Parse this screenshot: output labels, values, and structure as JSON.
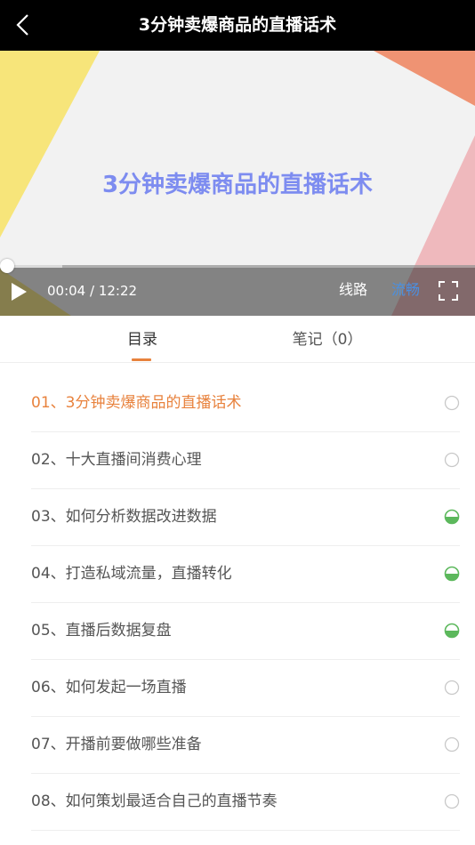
{
  "header": {
    "title": "3分钟卖爆商品的直播话术"
  },
  "video": {
    "slide_title": "3分钟卖爆商品的直播话术",
    "current_time": "00:04",
    "duration": "12:22",
    "route_label": "线路",
    "quality_label": "流畅",
    "progress_fraction": 0.005
  },
  "tabs": [
    {
      "label": "目录",
      "active": true
    },
    {
      "label": "笔记（0）",
      "active": false
    }
  ],
  "lessons": [
    {
      "label": "01、3分钟卖爆商品的直播话术",
      "status": "empty",
      "active": true
    },
    {
      "label": "02、十大直播间消费心理",
      "status": "empty",
      "active": false
    },
    {
      "label": "03、如何分析数据改进数据",
      "status": "half",
      "active": false
    },
    {
      "label": "04、打造私域流量，直播转化",
      "status": "half",
      "active": false
    },
    {
      "label": "05、直播后数据复盘",
      "status": "half",
      "active": false
    },
    {
      "label": "06、如何发起一场直播",
      "status": "empty",
      "active": false
    },
    {
      "label": "07、开播前要做哪些准备",
      "status": "empty",
      "active": false
    },
    {
      "label": "08、如何策划最适合自己的直播节奏",
      "status": "empty",
      "active": false
    }
  ],
  "colors": {
    "accent": "#e8823d",
    "progress_green": "#5cb85c",
    "quality_blue": "#4a90e2",
    "slide_title": "#7d8cf0"
  },
  "icons": {
    "back": "back-arrow-icon",
    "play": "play-icon",
    "fullscreen": "fullscreen-icon",
    "status_empty": "empty-circle-icon",
    "status_half": "half-filled-circle-icon"
  }
}
